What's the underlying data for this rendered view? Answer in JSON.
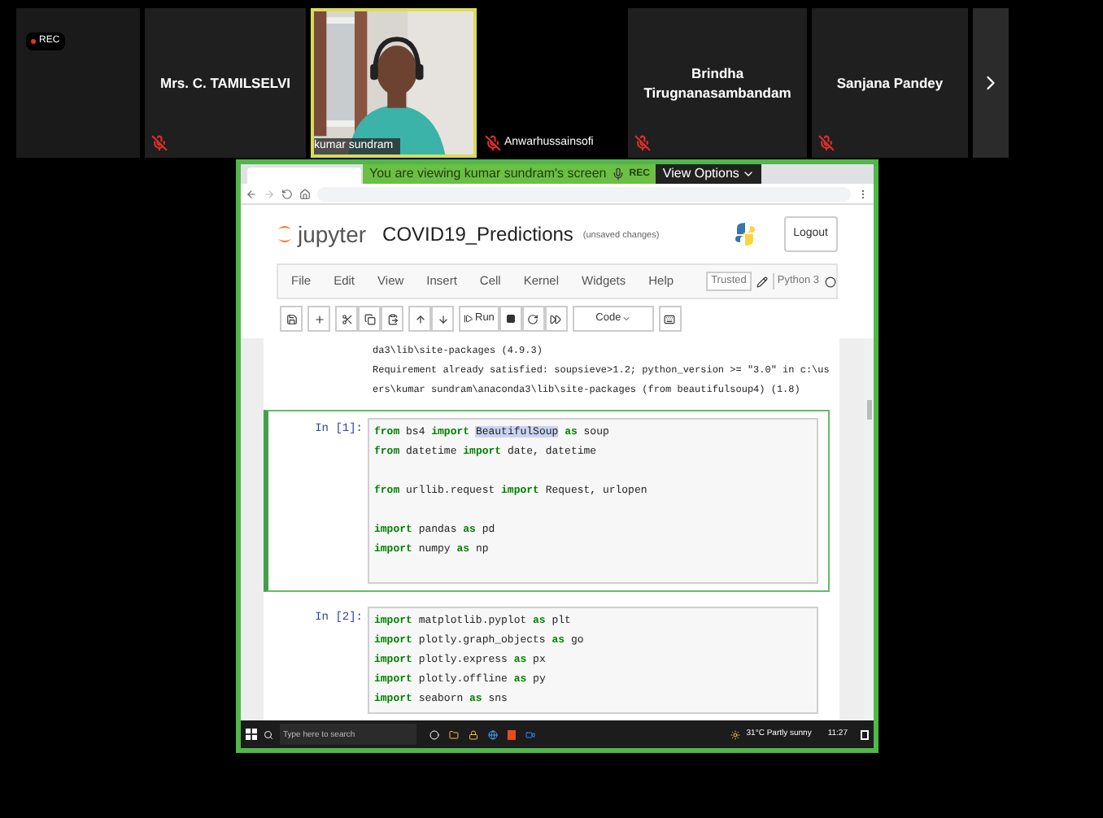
{
  "meeting": {
    "recording_badge": "REC",
    "participants": [
      {
        "kind": "name_tile",
        "name": "Mrs. C. TAMILSELVI",
        "muted": true,
        "speaking": false
      },
      {
        "kind": "video",
        "name": "kumar sundram",
        "muted": false,
        "speaking": true
      },
      {
        "kind": "video_off",
        "name": "Anwarhussainsofi",
        "muted": true,
        "speaking": false
      },
      {
        "kind": "name_tile",
        "name": "Brindha Tirugnanasambandam",
        "muted": true,
        "speaking": false
      },
      {
        "kind": "name_tile",
        "name": "Sanjana Pandey",
        "muted": true,
        "speaking": false
      }
    ]
  },
  "share_banner": {
    "text": "You are viewing kumar sundram's screen",
    "rec": "REC",
    "view_options": "View Options"
  },
  "jupyter": {
    "logo_text": "jupyter",
    "notebook_name": "COVID19_Predictions",
    "save_status": "(unsaved changes)",
    "logout": "Logout",
    "menu": [
      "File",
      "Edit",
      "View",
      "Insert",
      "Cell",
      "Kernel",
      "Widgets",
      "Help"
    ],
    "trusted": "Trusted",
    "kernel": "Python 3",
    "run": "Run",
    "cell_type": "Code"
  },
  "notebook": {
    "output_lines": [
      "da3\\lib\\site-packages (4.9.3)",
      "Requirement already satisfied: soupsieve>1.2; python_version >= \"3.0\" in c:\\us",
      "ers\\kumar sundram\\anaconda3\\lib\\site-packages (from beautifulsoup4) (1.8)"
    ],
    "cells": [
      {
        "prompt": "In [1]:",
        "selected": true,
        "lines": [
          {
            "kind": "code",
            "tokens": [
              {
                "kind": "keyword",
                "text": "from"
              },
              {
                "kind": "plain",
                "text": "bs4"
              },
              {
                "kind": "keyword",
                "text": "import"
              },
              {
                "kind": "highlight",
                "text": "BeautifulSoup"
              },
              {
                "kind": "keyword",
                "text": "as"
              },
              {
                "kind": "plain",
                "text": "soup"
              }
            ]
          },
          {
            "kind": "code",
            "tokens": [
              {
                "kind": "keyword",
                "text": "from"
              },
              {
                "kind": "plain",
                "text": "datetime"
              },
              {
                "kind": "keyword",
                "text": "import"
              },
              {
                "kind": "plain",
                "text": "date, datetime"
              }
            ]
          },
          {
            "kind": "blank"
          },
          {
            "kind": "code",
            "tokens": [
              {
                "kind": "keyword",
                "text": "from"
              },
              {
                "kind": "plain",
                "text": "urllib.request"
              },
              {
                "kind": "keyword",
                "text": "import"
              },
              {
                "kind": "plain",
                "text": "Request, urlopen"
              }
            ]
          },
          {
            "kind": "blank"
          },
          {
            "kind": "code",
            "tokens": [
              {
                "kind": "keyword",
                "text": "import"
              },
              {
                "kind": "plain",
                "text": "pandas"
              },
              {
                "kind": "keyword",
                "text": "as"
              },
              {
                "kind": "plain",
                "text": "pd"
              }
            ]
          },
          {
            "kind": "code",
            "tokens": [
              {
                "kind": "keyword",
                "text": "import"
              },
              {
                "kind": "plain",
                "text": "numpy"
              },
              {
                "kind": "keyword",
                "text": "as"
              },
              {
                "kind": "plain",
                "text": "np"
              }
            ]
          },
          {
            "kind": "blank"
          }
        ]
      },
      {
        "prompt": "In [2]:",
        "selected": false,
        "lines": [
          {
            "kind": "code",
            "tokens": [
              {
                "kind": "keyword",
                "text": "import"
              },
              {
                "kind": "plain",
                "text": "matplotlib.pyplot"
              },
              {
                "kind": "keyword",
                "text": "as"
              },
              {
                "kind": "plain",
                "text": "plt"
              }
            ]
          },
          {
            "kind": "code",
            "tokens": [
              {
                "kind": "keyword",
                "text": "import"
              },
              {
                "kind": "plain",
                "text": "plotly.graph_objects"
              },
              {
                "kind": "keyword",
                "text": "as"
              },
              {
                "kind": "plain",
                "text": "go"
              }
            ]
          },
          {
            "kind": "code",
            "tokens": [
              {
                "kind": "keyword",
                "text": "import"
              },
              {
                "kind": "plain",
                "text": "plotly.express"
              },
              {
                "kind": "keyword",
                "text": "as"
              },
              {
                "kind": "plain",
                "text": "px"
              }
            ]
          },
          {
            "kind": "code",
            "tokens": [
              {
                "kind": "keyword",
                "text": "import"
              },
              {
                "kind": "plain",
                "text": "plotly.offline"
              },
              {
                "kind": "keyword",
                "text": "as"
              },
              {
                "kind": "plain",
                "text": "py"
              }
            ]
          },
          {
            "kind": "code",
            "tokens": [
              {
                "kind": "keyword",
                "text": "import"
              },
              {
                "kind": "plain",
                "text": "seaborn"
              },
              {
                "kind": "keyword",
                "text": "as"
              },
              {
                "kind": "plain",
                "text": "sns"
              }
            ]
          }
        ]
      }
    ]
  },
  "taskbar": {
    "search_placeholder": "Type here to search",
    "weather": "31°C Partly sunny",
    "time": "11:27"
  }
}
